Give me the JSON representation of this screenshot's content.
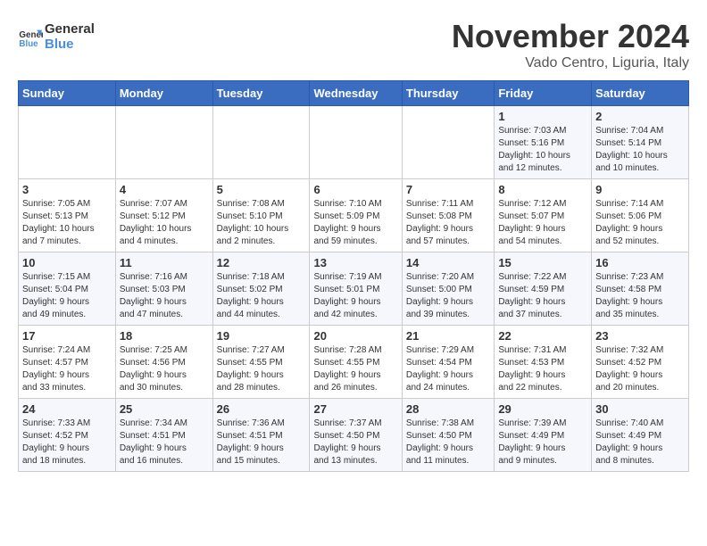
{
  "logo": {
    "line1": "General",
    "line2": "Blue"
  },
  "title": "November 2024",
  "location": "Vado Centro, Liguria, Italy",
  "weekdays": [
    "Sunday",
    "Monday",
    "Tuesday",
    "Wednesday",
    "Thursday",
    "Friday",
    "Saturday"
  ],
  "weeks": [
    [
      {
        "day": "",
        "info": ""
      },
      {
        "day": "",
        "info": ""
      },
      {
        "day": "",
        "info": ""
      },
      {
        "day": "",
        "info": ""
      },
      {
        "day": "",
        "info": ""
      },
      {
        "day": "1",
        "info": "Sunrise: 7:03 AM\nSunset: 5:16 PM\nDaylight: 10 hours\nand 12 minutes."
      },
      {
        "day": "2",
        "info": "Sunrise: 7:04 AM\nSunset: 5:14 PM\nDaylight: 10 hours\nand 10 minutes."
      }
    ],
    [
      {
        "day": "3",
        "info": "Sunrise: 7:05 AM\nSunset: 5:13 PM\nDaylight: 10 hours\nand 7 minutes."
      },
      {
        "day": "4",
        "info": "Sunrise: 7:07 AM\nSunset: 5:12 PM\nDaylight: 10 hours\nand 4 minutes."
      },
      {
        "day": "5",
        "info": "Sunrise: 7:08 AM\nSunset: 5:10 PM\nDaylight: 10 hours\nand 2 minutes."
      },
      {
        "day": "6",
        "info": "Sunrise: 7:10 AM\nSunset: 5:09 PM\nDaylight: 9 hours\nand 59 minutes."
      },
      {
        "day": "7",
        "info": "Sunrise: 7:11 AM\nSunset: 5:08 PM\nDaylight: 9 hours\nand 57 minutes."
      },
      {
        "day": "8",
        "info": "Sunrise: 7:12 AM\nSunset: 5:07 PM\nDaylight: 9 hours\nand 54 minutes."
      },
      {
        "day": "9",
        "info": "Sunrise: 7:14 AM\nSunset: 5:06 PM\nDaylight: 9 hours\nand 52 minutes."
      }
    ],
    [
      {
        "day": "10",
        "info": "Sunrise: 7:15 AM\nSunset: 5:04 PM\nDaylight: 9 hours\nand 49 minutes."
      },
      {
        "day": "11",
        "info": "Sunrise: 7:16 AM\nSunset: 5:03 PM\nDaylight: 9 hours\nand 47 minutes."
      },
      {
        "day": "12",
        "info": "Sunrise: 7:18 AM\nSunset: 5:02 PM\nDaylight: 9 hours\nand 44 minutes."
      },
      {
        "day": "13",
        "info": "Sunrise: 7:19 AM\nSunset: 5:01 PM\nDaylight: 9 hours\nand 42 minutes."
      },
      {
        "day": "14",
        "info": "Sunrise: 7:20 AM\nSunset: 5:00 PM\nDaylight: 9 hours\nand 39 minutes."
      },
      {
        "day": "15",
        "info": "Sunrise: 7:22 AM\nSunset: 4:59 PM\nDaylight: 9 hours\nand 37 minutes."
      },
      {
        "day": "16",
        "info": "Sunrise: 7:23 AM\nSunset: 4:58 PM\nDaylight: 9 hours\nand 35 minutes."
      }
    ],
    [
      {
        "day": "17",
        "info": "Sunrise: 7:24 AM\nSunset: 4:57 PM\nDaylight: 9 hours\nand 33 minutes."
      },
      {
        "day": "18",
        "info": "Sunrise: 7:25 AM\nSunset: 4:56 PM\nDaylight: 9 hours\nand 30 minutes."
      },
      {
        "day": "19",
        "info": "Sunrise: 7:27 AM\nSunset: 4:55 PM\nDaylight: 9 hours\nand 28 minutes."
      },
      {
        "day": "20",
        "info": "Sunrise: 7:28 AM\nSunset: 4:55 PM\nDaylight: 9 hours\nand 26 minutes."
      },
      {
        "day": "21",
        "info": "Sunrise: 7:29 AM\nSunset: 4:54 PM\nDaylight: 9 hours\nand 24 minutes."
      },
      {
        "day": "22",
        "info": "Sunrise: 7:31 AM\nSunset: 4:53 PM\nDaylight: 9 hours\nand 22 minutes."
      },
      {
        "day": "23",
        "info": "Sunrise: 7:32 AM\nSunset: 4:52 PM\nDaylight: 9 hours\nand 20 minutes."
      }
    ],
    [
      {
        "day": "24",
        "info": "Sunrise: 7:33 AM\nSunset: 4:52 PM\nDaylight: 9 hours\nand 18 minutes."
      },
      {
        "day": "25",
        "info": "Sunrise: 7:34 AM\nSunset: 4:51 PM\nDaylight: 9 hours\nand 16 minutes."
      },
      {
        "day": "26",
        "info": "Sunrise: 7:36 AM\nSunset: 4:51 PM\nDaylight: 9 hours\nand 15 minutes."
      },
      {
        "day": "27",
        "info": "Sunrise: 7:37 AM\nSunset: 4:50 PM\nDaylight: 9 hours\nand 13 minutes."
      },
      {
        "day": "28",
        "info": "Sunrise: 7:38 AM\nSunset: 4:50 PM\nDaylight: 9 hours\nand 11 minutes."
      },
      {
        "day": "29",
        "info": "Sunrise: 7:39 AM\nSunset: 4:49 PM\nDaylight: 9 hours\nand 9 minutes."
      },
      {
        "day": "30",
        "info": "Sunrise: 7:40 AM\nSunset: 4:49 PM\nDaylight: 9 hours\nand 8 minutes."
      }
    ]
  ]
}
